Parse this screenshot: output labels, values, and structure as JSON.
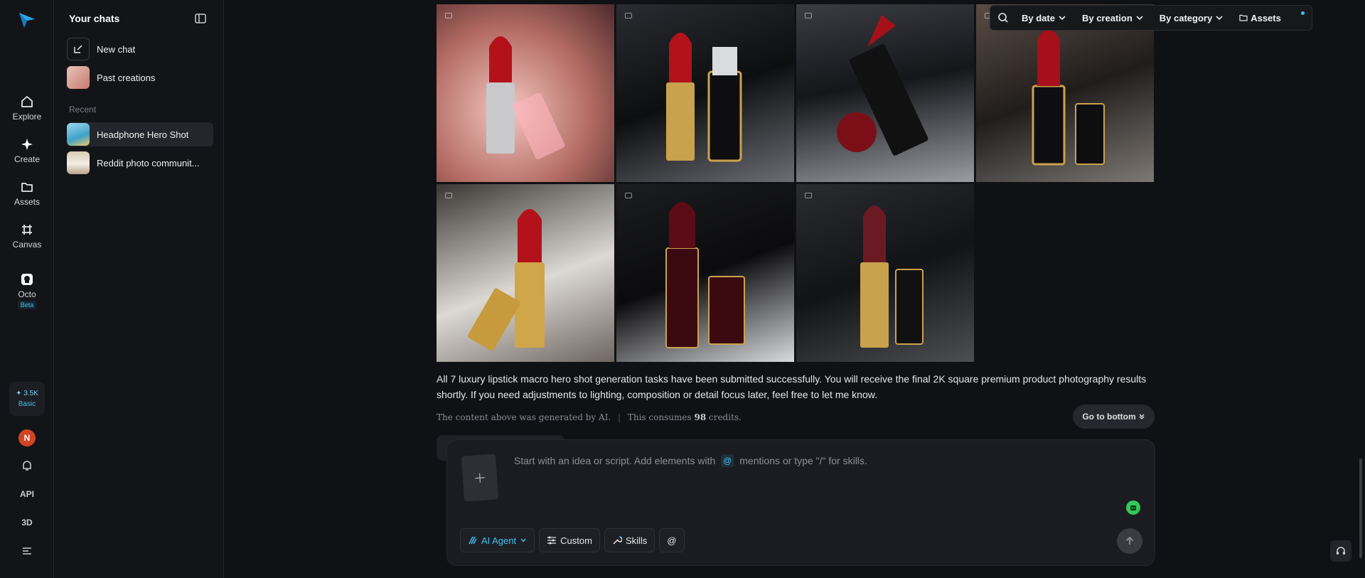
{
  "rail": {
    "items": [
      {
        "label": "Explore",
        "icon": "home-icon"
      },
      {
        "label": "Create",
        "icon": "sparkle-icon"
      },
      {
        "label": "Assets",
        "icon": "folder-icon"
      },
      {
        "label": "Canvas",
        "icon": "canvas-icon"
      },
      {
        "label": "Octo",
        "icon": "octo-icon"
      }
    ],
    "octo_badge": "Beta",
    "credits": "3.5K",
    "plan": "Basic",
    "avatar_initial": "N",
    "api_label": "API",
    "three_d_label": "3D"
  },
  "chats": {
    "title": "Your chats",
    "new_chat": "New chat",
    "past_creations": "Past creations",
    "recent_label": "Recent",
    "recent": [
      {
        "label": "Headphone Hero Shot"
      },
      {
        "label": "Reddit photo communit..."
      }
    ]
  },
  "toolbar": {
    "by_date": "By date",
    "by_creation": "By creation",
    "by_category": "By category",
    "assets": "Assets"
  },
  "message": {
    "text": "All 7 luxury lipstick macro hero shot generation tasks have been submitted successfully. You will receive the final 2K square premium product photography results shortly. If you need adjustments to lighting, composition or detail focus later, feel free to let me know.",
    "disclaimer": "The content above was generated by AI.",
    "consumes_prefix": "This consumes",
    "credits_used": "98",
    "consumes_suffix": "credits.",
    "go_to_bottom": "Go to bottom"
  },
  "composer": {
    "placeholder_before": "Start with an idea or script. Add elements with",
    "placeholder_after": "mentions or type \"/\" for skills.",
    "agent_label": "AI Agent",
    "custom_label": "Custom",
    "skills_label": "Skills",
    "at_label": "@"
  },
  "colors": {
    "accent": "#41c1f0",
    "background": "#101114"
  }
}
